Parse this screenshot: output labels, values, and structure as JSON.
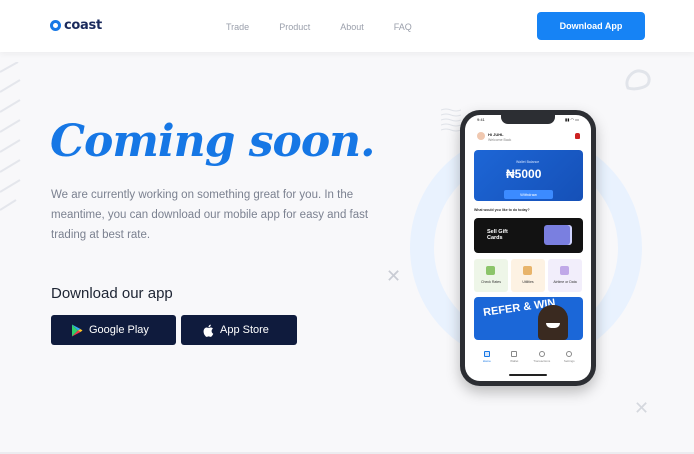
{
  "header": {
    "logo_text": "coast",
    "nav": [
      "Trade",
      "Product",
      "About",
      "FAQ"
    ],
    "download_button": "Download App"
  },
  "hero": {
    "title": "Coming soon.",
    "text": "We are currently working on something great for you. In the meantime, you can download our mobile app for easy and fast trading at best rate.",
    "download_title": "Download our app",
    "google_play": "Google Play",
    "app_store": "App Store"
  },
  "phone": {
    "time": "9:41",
    "status": "▮▮ ◠ ▭",
    "greeting_name": "Hi JUHL",
    "greeting_sub": "Welcome Back",
    "balance_label": "Wallet Balance",
    "balance_value": "₦5000",
    "withdraw": "Withdraw",
    "question": "What would you like to do today?",
    "gift_card": "Sell Gift Cards",
    "tiles": [
      "Check Rates",
      "Utilities",
      "Airtime or Data"
    ],
    "promo": "REFER & WIN",
    "tabs": [
      "Home",
      "Wallet",
      "Transactions",
      "Settings"
    ]
  },
  "colors": {
    "brand": "#1677e5",
    "button": "#1683f5",
    "store_button": "#0f1b3d"
  },
  "icons": {
    "google_play": "google-play-icon",
    "apple": "apple-icon"
  }
}
